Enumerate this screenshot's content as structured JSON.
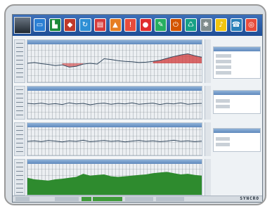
{
  "colors": {
    "toolbar": "#1f4e96",
    "trace_primary": "#34495e",
    "trace_alert": "#d23a3a",
    "area_fill": "#2e8b2e",
    "status_active": "#3f9a3a"
  },
  "toolbar": {
    "buttons": [
      {
        "name": "monitor-icon",
        "color": "#2a7fd4",
        "glyph": "▭"
      },
      {
        "name": "flag-icon",
        "color": "#1b8a3a",
        "glyph": "▙"
      },
      {
        "name": "palette-icon",
        "color": "#c0392b",
        "glyph": "◆"
      },
      {
        "name": "refresh-icon",
        "color": "#2d8fd5",
        "glyph": "↻"
      },
      {
        "name": "document-icon",
        "color": "#d63a3a",
        "glyph": "▤"
      },
      {
        "name": "flame-icon",
        "color": "#e67e22",
        "glyph": "▲"
      },
      {
        "name": "warning-icon",
        "color": "#e74c3c",
        "glyph": "!"
      },
      {
        "name": "stop-icon",
        "color": "#e02d2d",
        "glyph": "●"
      },
      {
        "name": "pencil-icon",
        "color": "#27ae60",
        "glyph": "✎"
      },
      {
        "name": "power-icon",
        "color": "#d35400",
        "glyph": "⏻"
      },
      {
        "name": "recycle-icon",
        "color": "#16a085",
        "glyph": "♺"
      },
      {
        "name": "gear-icon",
        "color": "#7f8c8d",
        "glyph": "✱"
      },
      {
        "name": "bell-icon",
        "color": "#f1c40f",
        "glyph": "♪"
      },
      {
        "name": "phone-icon",
        "color": "#2980b9",
        "glyph": "☎"
      },
      {
        "name": "alarm-icon",
        "color": "#e74c3c",
        "glyph": "◎"
      }
    ]
  },
  "brand_text": "SYNCRO",
  "chart_data": [
    {
      "type": "line",
      "series": [
        {
          "values": [
            0.5,
            0.52,
            0.49,
            0.47,
            0.44,
            0.46,
            0.4,
            0.42,
            0.48,
            0.5,
            0.48,
            0.62,
            0.6,
            0.57,
            0.55,
            0.54,
            0.52,
            0.53,
            0.55,
            0.58,
            0.63,
            0.68,
            0.72,
            0.75,
            0.7,
            0.66
          ]
        }
      ]
    },
    {
      "type": "line",
      "series": [
        {
          "values": [
            0.55,
            0.53,
            0.56,
            0.52,
            0.54,
            0.51,
            0.57,
            0.53,
            0.55,
            0.5,
            0.54,
            0.56,
            0.52,
            0.55,
            0.53,
            0.57,
            0.52,
            0.54,
            0.56,
            0.51,
            0.55,
            0.53,
            0.57,
            0.52,
            0.54,
            0.55
          ]
        }
      ]
    },
    {
      "type": "line",
      "series": [
        {
          "values": [
            0.5,
            0.52,
            0.49,
            0.53,
            0.51,
            0.48,
            0.52,
            0.5,
            0.54,
            0.49,
            0.51,
            0.53,
            0.5,
            0.52,
            0.48,
            0.51,
            0.53,
            0.5,
            0.52,
            0.49,
            0.51,
            0.54,
            0.5,
            0.52,
            0.49,
            0.51
          ]
        }
      ]
    },
    {
      "type": "area",
      "series": [
        {
          "values": [
            0.55,
            0.5,
            0.48,
            0.46,
            0.5,
            0.52,
            0.55,
            0.58,
            0.68,
            0.62,
            0.64,
            0.66,
            0.6,
            0.58,
            0.6,
            0.62,
            0.64,
            0.66,
            0.7,
            0.72,
            0.74,
            0.7,
            0.66,
            0.68,
            0.64,
            0.62
          ]
        }
      ]
    }
  ]
}
